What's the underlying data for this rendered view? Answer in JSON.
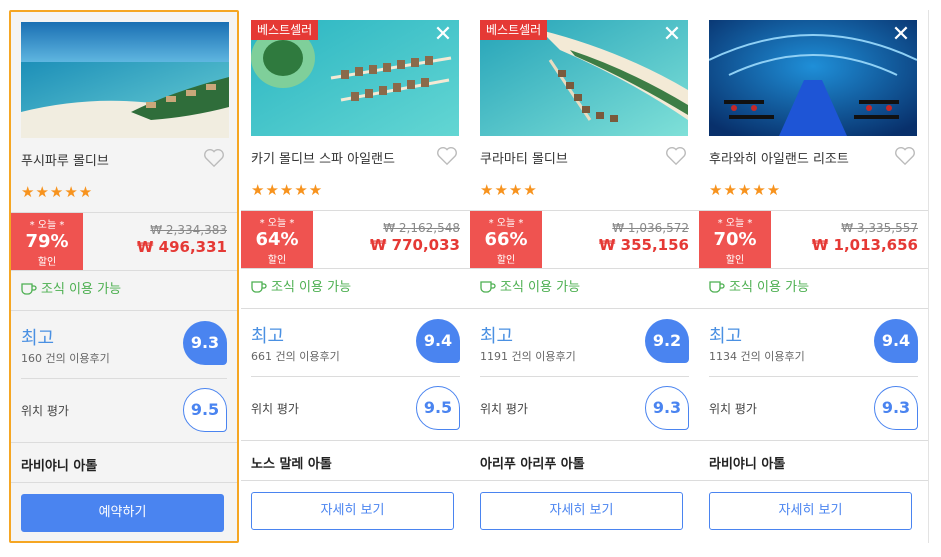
{
  "cards": [
    {
      "name": "푸시파루 몰디브",
      "stars": "★★★★★",
      "best_label": "",
      "deal_today": "* 오늘 *",
      "discount": "79%",
      "discount_suffix": "할인",
      "old_price": "₩ 2,334,383",
      "new_price": "₩ 496,331",
      "breakfast": "조식 이용 가능",
      "rating_word": "최고",
      "reviews": "160 건의 이용후기",
      "score": "9.3",
      "location_label": "위치 평가",
      "location_score": "9.5",
      "area": "라비야니 아톨",
      "button": "예약하기"
    },
    {
      "name": "카기 몰디브 스파 아일랜드",
      "stars": "★★★★★",
      "best_label": "베스트셀러",
      "deal_today": "* 오늘 *",
      "discount": "64%",
      "discount_suffix": "할인",
      "old_price": "₩ 2,162,548",
      "new_price": "₩ 770,033",
      "breakfast": "조식 이용 가능",
      "rating_word": "최고",
      "reviews": "661 건의 이용후기",
      "score": "9.4",
      "location_label": "위치 평가",
      "location_score": "9.5",
      "area": "노스 말레 아톨",
      "button": "자세히 보기"
    },
    {
      "name": "쿠라마티 몰디브",
      "stars": "★★★★",
      "best_label": "베스트셀러",
      "deal_today": "* 오늘 *",
      "discount": "66%",
      "discount_suffix": "할인",
      "old_price": "₩ 1,036,572",
      "new_price": "₩ 355,156",
      "breakfast": "조식 이용 가능",
      "rating_word": "최고",
      "reviews": "1191 건의 이용후기",
      "score": "9.2",
      "location_label": "위치 평가",
      "location_score": "9.3",
      "area": "아리푸 아리푸 아톨",
      "button": "자세히 보기"
    },
    {
      "name": "후라와히 아일랜드 리조트",
      "stars": "★★★★★",
      "best_label": "",
      "deal_today": "* 오늘 *",
      "discount": "70%",
      "discount_suffix": "할인",
      "old_price": "₩ 3,335,557",
      "new_price": "₩ 1,013,656",
      "breakfast": "조식 이용 가능",
      "rating_word": "최고",
      "reviews": "1134 건의 이용후기",
      "score": "9.4",
      "location_label": "위치 평가",
      "location_score": "9.3",
      "area": "라비야니 아톨",
      "button": "자세히 보기"
    }
  ],
  "colors": {
    "accent": "#4a84f0",
    "deal": "#ef5350",
    "price": "#e53935",
    "star": "#f7931e",
    "breakfast": "#4caf50",
    "selected_border": "#f5a623"
  }
}
